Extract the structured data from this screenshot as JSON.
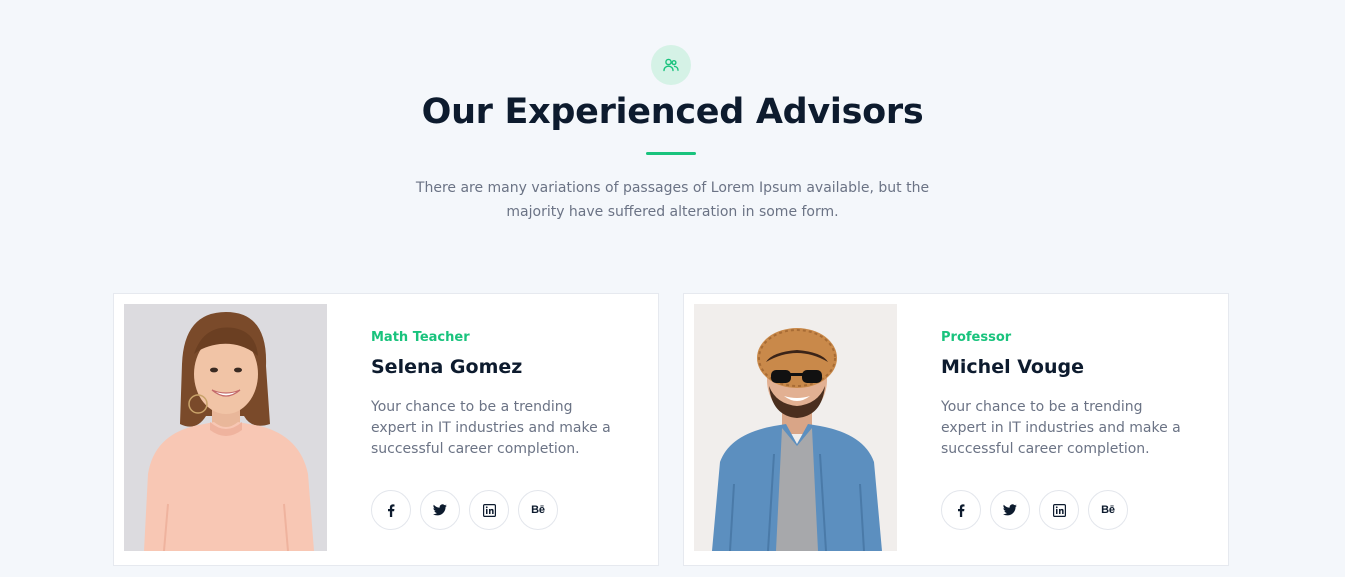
{
  "header": {
    "icon": "users-icon",
    "title": "Our Experienced Advisors",
    "subtitle": "There are many variations of passages of Lorem Ipsum available, but the majority have suffered alteration in some form.",
    "accent_color": "#19c37d",
    "icon_bg_color": "#d5f2e6"
  },
  "advisors": [
    {
      "role": "Math Teacher",
      "name": "Selena Gomez",
      "description": "Your chance to be a trending expert in IT industries and make a successful career completion.",
      "photo": "advisor-photo-woman-pink-sweater",
      "socials": [
        {
          "icon": "facebook-icon"
        },
        {
          "icon": "twitter-icon"
        },
        {
          "icon": "linkedin-icon"
        },
        {
          "icon": "behance-icon",
          "label": "Bē"
        }
      ]
    },
    {
      "role": "Professor",
      "name": "Michel Vouge",
      "description": "Your chance to be a trending expert in IT industries and make a successful career completion.",
      "photo": "advisor-photo-man-hat-sunglasses",
      "socials": [
        {
          "icon": "facebook-icon"
        },
        {
          "icon": "twitter-icon"
        },
        {
          "icon": "linkedin-icon"
        },
        {
          "icon": "behance-icon",
          "label": "Bē"
        }
      ]
    }
  ]
}
